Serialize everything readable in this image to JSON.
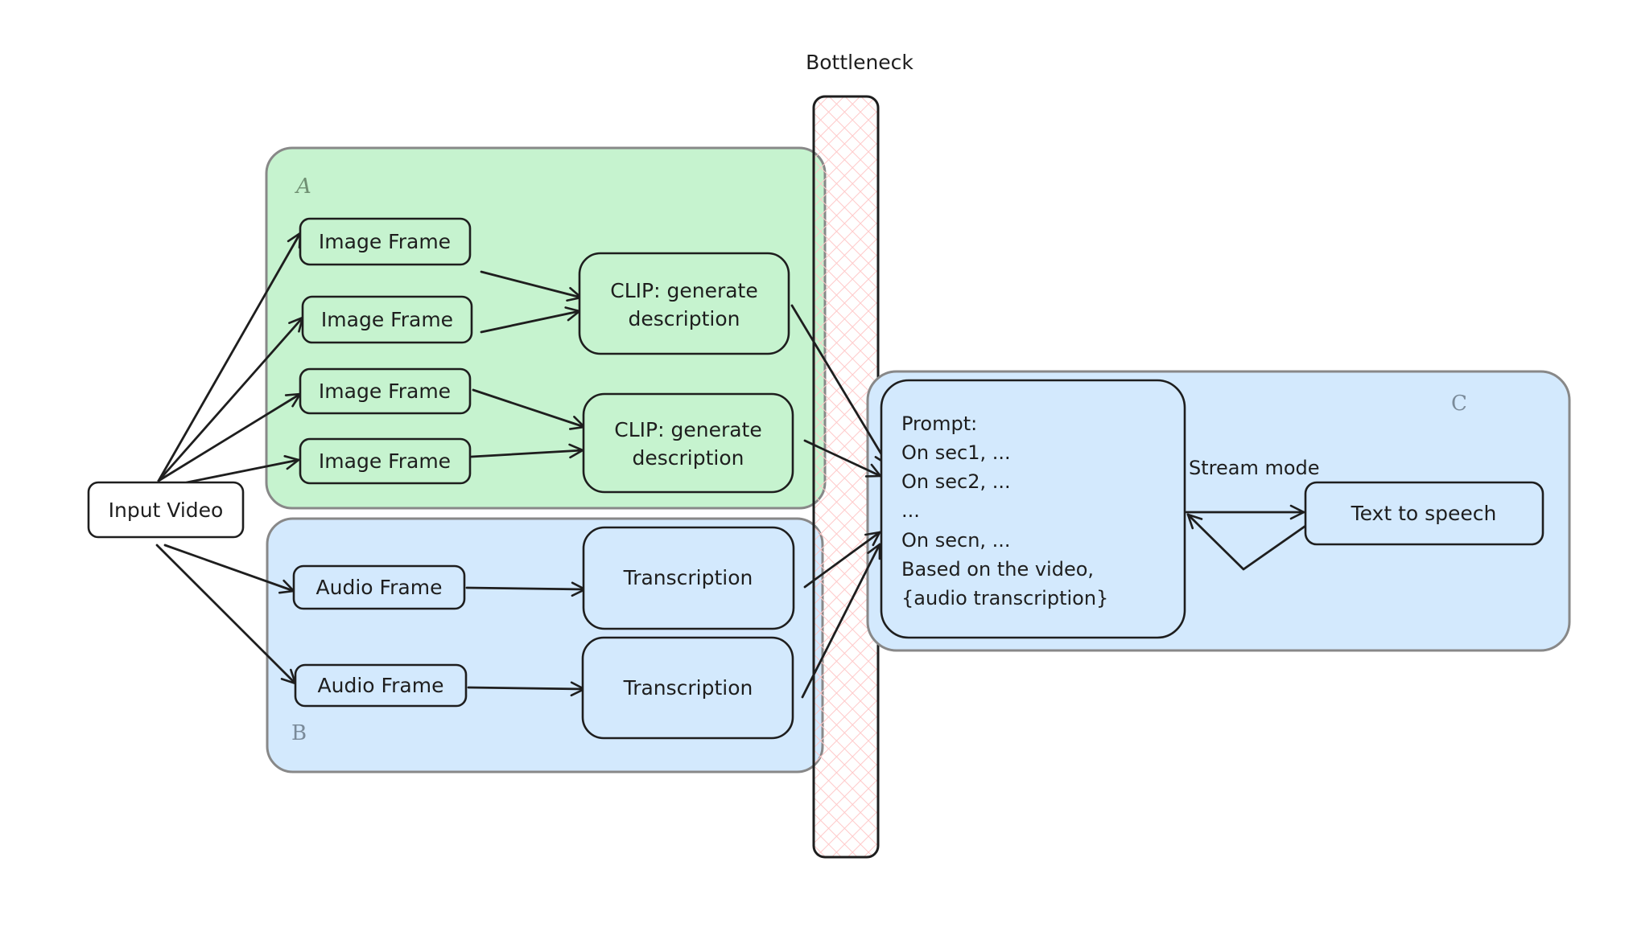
{
  "diagram": {
    "bottleneck_label": "Bottleneck",
    "colors": {
      "group_a_fill": "#c6f3cf",
      "group_b_fill": "#d3e9fd",
      "group_c_fill": "#d3e9fd",
      "group_stroke": "#888888",
      "bottleneck_hatch": "#ffc9c9",
      "ink": "#1e1e1e",
      "group_a_label": "#6f8f72",
      "group_bc_label": "#7a8a99"
    },
    "groups": {
      "a": {
        "label": "A"
      },
      "b": {
        "label": "B"
      },
      "c": {
        "label": "C"
      }
    },
    "nodes": {
      "input_video": "Input Video",
      "image_frame_1": "Image Frame",
      "image_frame_2": "Image Frame",
      "image_frame_3": "Image Frame",
      "image_frame_4": "Image Frame",
      "clip_1": [
        "CLIP: generate",
        "description"
      ],
      "clip_2": [
        "CLIP: generate",
        "description"
      ],
      "audio_frame_1": "Audio Frame",
      "audio_frame_2": "Audio Frame",
      "transcription_1": "Transcription",
      "transcription_2": "Transcription",
      "prompt": [
        "Prompt:",
        "On sec1, ...",
        "On sec2, ...",
        "...",
        "On secn, ...",
        "Based on the video,",
        "{audio transcription}"
      ],
      "text_to_speech": "Text to speech"
    },
    "edge_labels": {
      "stream_mode": "Stream mode"
    },
    "edges": [
      [
        "input_video",
        "image_frame_1"
      ],
      [
        "input_video",
        "image_frame_2"
      ],
      [
        "input_video",
        "image_frame_3"
      ],
      [
        "input_video",
        "image_frame_4"
      ],
      [
        "input_video",
        "audio_frame_1"
      ],
      [
        "input_video",
        "audio_frame_2"
      ],
      [
        "image_frame_1",
        "clip_1"
      ],
      [
        "image_frame_2",
        "clip_1"
      ],
      [
        "image_frame_3",
        "clip_2"
      ],
      [
        "image_frame_4",
        "clip_2"
      ],
      [
        "audio_frame_1",
        "transcription_1"
      ],
      [
        "audio_frame_2",
        "transcription_2"
      ],
      [
        "clip_1",
        "prompt"
      ],
      [
        "clip_2",
        "prompt"
      ],
      [
        "transcription_1",
        "prompt"
      ],
      [
        "transcription_2",
        "prompt"
      ],
      [
        "prompt",
        "text_to_speech"
      ],
      [
        "text_to_speech",
        "prompt"
      ]
    ]
  }
}
